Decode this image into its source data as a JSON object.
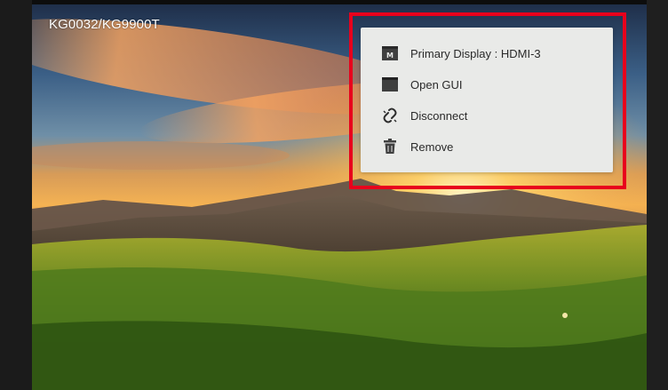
{
  "window": {
    "device_label": "KG0032/KG9900T"
  },
  "context_menu": {
    "items": [
      {
        "label": "Primary Display : HDMI-3",
        "icon": "monitor-m-icon"
      },
      {
        "label": "Open GUI",
        "icon": "window-icon"
      },
      {
        "label": "Disconnect",
        "icon": "broken-link-icon"
      },
      {
        "label": "Remove",
        "icon": "trash-icon"
      }
    ]
  },
  "colors": {
    "highlight_border": "#e8001c",
    "menu_background": "#e9eae8",
    "icon_dark": "#3f3f3f"
  }
}
